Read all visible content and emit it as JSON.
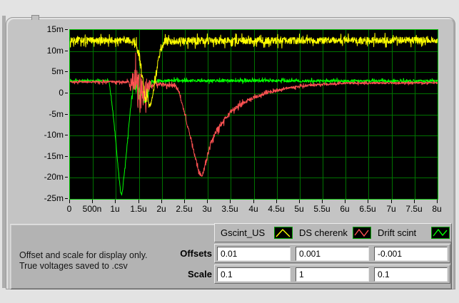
{
  "note": {
    "line1": "Offset and scale for display only.",
    "line2": "True voltages saved to .csv"
  },
  "controls": {
    "offsets_label": "Offsets",
    "scale_label": "Scale",
    "offsets": [
      "0.01",
      "0.001",
      "-0.001"
    ],
    "scale": [
      "0.1",
      "1",
      "0.1"
    ]
  },
  "legend": {
    "items": [
      {
        "label": "Gscint_US",
        "color": "#ffff00"
      },
      {
        "label": "DS cherenk",
        "color": "#ff5252"
      },
      {
        "label": "Drift scint",
        "color": "#00ff00"
      }
    ]
  },
  "chart_data": {
    "type": "line",
    "title": "",
    "xlabel": "",
    "ylabel": "",
    "xlim_us": [
      0,
      8
    ],
    "ylim_mv": [
      -25,
      15
    ],
    "grid": true,
    "plot_bg": "#000000",
    "grid_color": "#007300",
    "border_color": "#00c000",
    "x_ticks": [
      "0",
      "500n",
      "1u",
      "1.5u",
      "2u",
      "2.5u",
      "3u",
      "3.5u",
      "4u",
      "4.5u",
      "5u",
      "5.5u",
      "6u",
      "6.5u",
      "7u",
      "7.5u",
      "8u"
    ],
    "y_ticks": [
      "15m",
      "10m",
      "5m",
      "0",
      "-5m",
      "-10m",
      "-15m",
      "-20m",
      "-25m"
    ],
    "legend_position": "bottom-right",
    "series": [
      {
        "name": "Drift scint",
        "color": "#00ff00",
        "seed": 77,
        "keypoints": [
          [
            0,
            3.0,
            0.3
          ],
          [
            0.85,
            3.0,
            0.3
          ],
          [
            0.93,
            -4.0,
            0.5
          ],
          [
            1.02,
            -14.0,
            0.5
          ],
          [
            1.1,
            -23.5,
            0.4
          ],
          [
            1.13,
            -24.0,
            0.3
          ],
          [
            1.2,
            -17.5,
            0.5
          ],
          [
            1.3,
            -5.5,
            0.6
          ],
          [
            1.37,
            1.0,
            1.3
          ],
          [
            1.45,
            2.3,
            1.4
          ],
          [
            1.54,
            0.3,
            1.8
          ],
          [
            1.62,
            -1.2,
            1.6
          ],
          [
            1.7,
            0.8,
            1.6
          ],
          [
            1.78,
            2.6,
            0.8
          ],
          [
            1.95,
            3.0,
            0.45
          ],
          [
            8,
            2.9,
            0.4
          ]
        ]
      },
      {
        "name": "DS cherenk",
        "color": "#ff5252",
        "seed": 42,
        "keypoints": [
          [
            0,
            2.7,
            0.3
          ],
          [
            1.28,
            2.7,
            0.4
          ],
          [
            1.34,
            2.0,
            3.5
          ],
          [
            1.42,
            1.2,
            6.0
          ],
          [
            1.5,
            0.8,
            6.2
          ],
          [
            1.58,
            0.2,
            5.0
          ],
          [
            1.66,
            0.5,
            3.5
          ],
          [
            1.74,
            1.8,
            1.8
          ],
          [
            1.82,
            2.1,
            0.9
          ],
          [
            1.95,
            2.3,
            0.7
          ],
          [
            2.1,
            1.8,
            0.6
          ],
          [
            2.25,
            1.9,
            0.5
          ],
          [
            2.35,
            1.0,
            0.5
          ],
          [
            2.45,
            -3.0,
            0.6
          ],
          [
            2.58,
            -8.5,
            0.7
          ],
          [
            2.7,
            -14.0,
            0.8
          ],
          [
            2.8,
            -18.5,
            0.8
          ],
          [
            2.87,
            -19.8,
            0.6
          ],
          [
            2.95,
            -16.5,
            0.9
          ],
          [
            3.05,
            -12.5,
            1.0
          ],
          [
            3.18,
            -9.0,
            0.9
          ],
          [
            3.32,
            -6.8,
            0.8
          ],
          [
            3.5,
            -4.3,
            0.7
          ],
          [
            3.72,
            -2.6,
            0.6
          ],
          [
            4.0,
            -1.0,
            0.5
          ],
          [
            4.3,
            0.1,
            0.45
          ],
          [
            4.7,
            1.2,
            0.4
          ],
          [
            5.2,
            1.9,
            0.35
          ],
          [
            6.0,
            2.4,
            0.3
          ],
          [
            8,
            2.5,
            0.3
          ]
        ]
      },
      {
        "name": "Gscint_US",
        "color": "#ffff00",
        "seed": 13,
        "keypoints": [
          [
            0,
            12.6,
            1.0
          ],
          [
            1.4,
            12.5,
            1.0
          ],
          [
            1.5,
            9.5,
            1.6
          ],
          [
            1.58,
            3.5,
            1.6
          ],
          [
            1.645,
            -2.0,
            0.8
          ],
          [
            1.675,
            0.5,
            0.8
          ],
          [
            1.72,
            -3.2,
            0.6
          ],
          [
            1.78,
            -1.8,
            0.9
          ],
          [
            1.86,
            3.5,
            1.5
          ],
          [
            1.96,
            10.0,
            1.4
          ],
          [
            2.06,
            12.4,
            1.1
          ],
          [
            8,
            12.6,
            1.0
          ]
        ]
      }
    ]
  }
}
